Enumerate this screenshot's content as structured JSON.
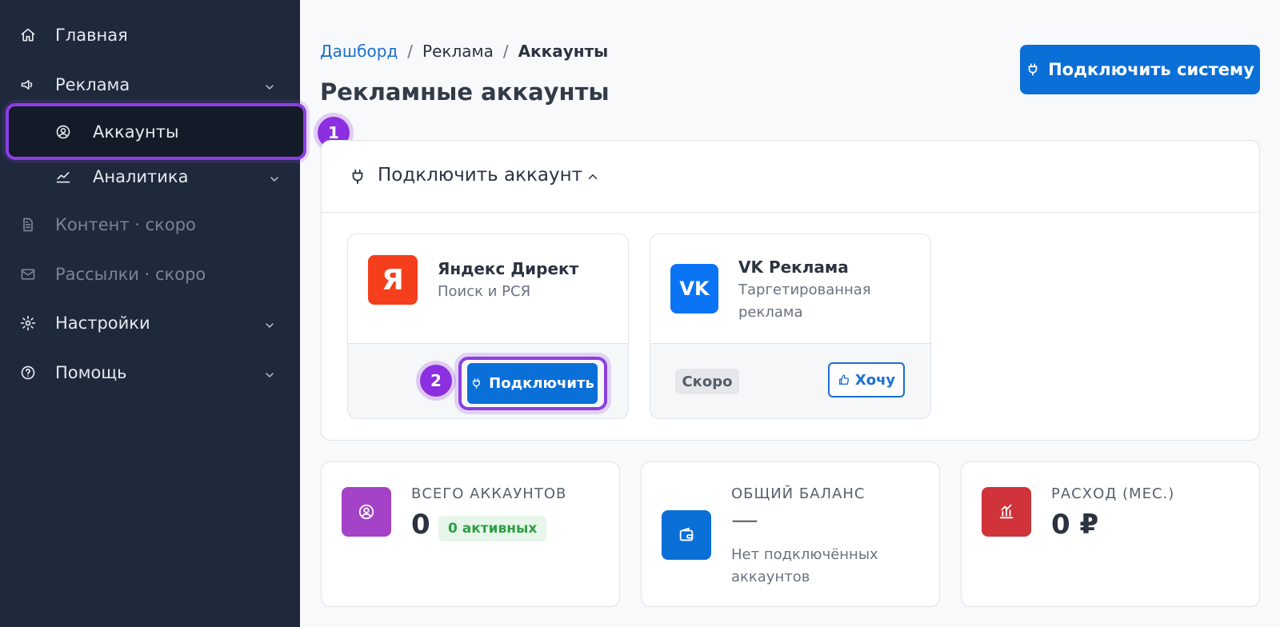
{
  "sidebar": {
    "items": [
      {
        "label": "Главная"
      },
      {
        "label": "Реклама"
      },
      {
        "label": "Аккаунты"
      },
      {
        "label": "Аналитика"
      },
      {
        "label": "Контент · скоро"
      },
      {
        "label": "Рассылки · скоро"
      },
      {
        "label": "Настройки"
      },
      {
        "label": "Помощь"
      }
    ]
  },
  "steps": {
    "one": "1",
    "two": "2"
  },
  "breadcrumb": {
    "dashboard": "Дашборд",
    "sep": "/",
    "ads": "Реклама",
    "current": "Аккаунты"
  },
  "page": {
    "title": "Рекламные аккаунты"
  },
  "header": {
    "connect_system_label": "Подключить систему"
  },
  "connect_panel": {
    "title": "Подключить аккаунт",
    "yandex": {
      "logo": "Я",
      "name": "Яндекс Директ",
      "desc": "Поиск и РСЯ",
      "button": "Подключить"
    },
    "vk": {
      "logo": "VK",
      "name": "VK Реклама",
      "desc": "Таргетированная реклама",
      "badge": "Скоро",
      "button": "Хочу"
    }
  },
  "stats": {
    "accounts": {
      "label": "ВСЕГО АККАУНТОВ",
      "value": "0",
      "pill": "0 активных"
    },
    "balance": {
      "label": "ОБЩИЙ БАЛАНС",
      "value": "—",
      "note": "Нет подключённых аккаунтов"
    },
    "spend": {
      "label": "РАСХОД (МЕС.)",
      "value": "0 ₽"
    }
  },
  "colors": {
    "sidebar_bg": "#1e293b",
    "accent": "#0b6fd8",
    "highlight": "#8b3fe0",
    "yandex": "#f43e1c",
    "vk": "#0a74f5",
    "accounts_icon": "#a442c8",
    "balance_icon": "#0b6fd8",
    "spend_icon": "#d0333a"
  }
}
